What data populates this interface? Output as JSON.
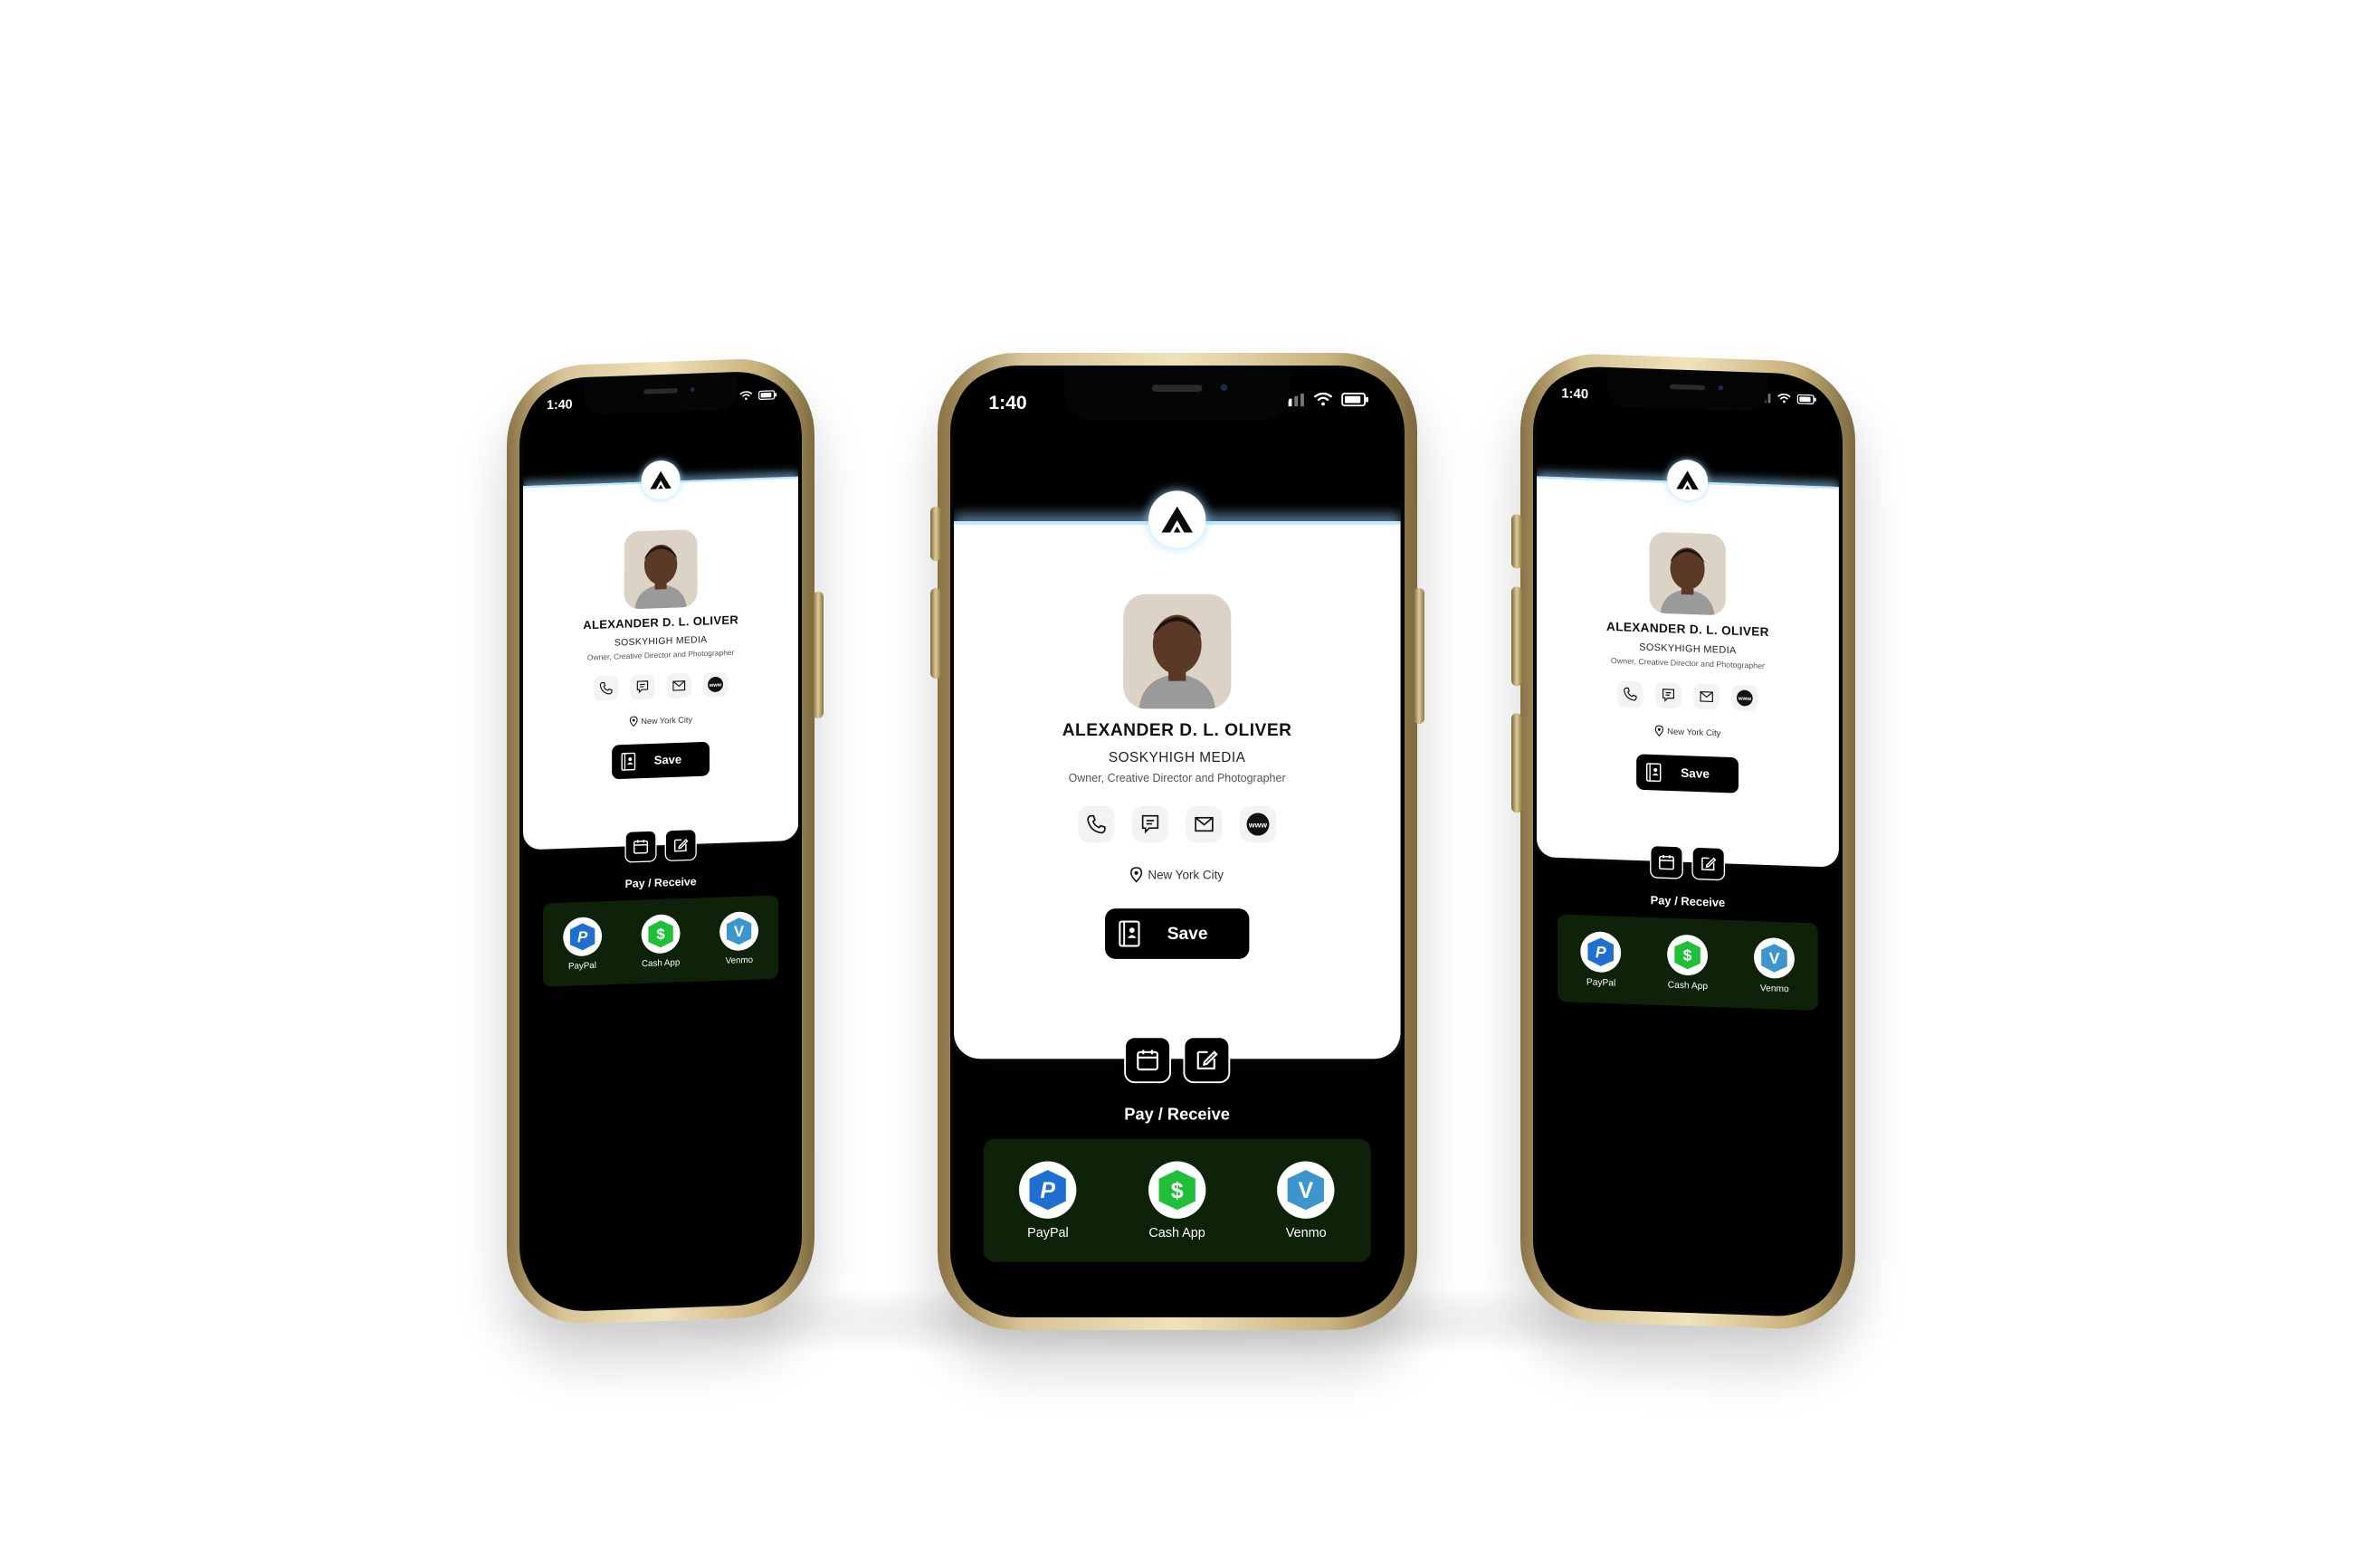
{
  "status": {
    "time": "1:40"
  },
  "logo": {
    "icon": "a-mountain-logo-icon"
  },
  "profile": {
    "name": "ALEXANDER D. L. OLIVER",
    "company": "SOSKYHIGH MEDIA",
    "role": "Owner, Creative Director and Photographer",
    "location": "New York City"
  },
  "contact_actions": [
    {
      "icon": "phone-icon"
    },
    {
      "icon": "message-icon"
    },
    {
      "icon": "email-icon"
    },
    {
      "icon": "website-icon",
      "text": "www"
    }
  ],
  "save_button": {
    "label": "Save",
    "icon": "contact-book-icon"
  },
  "tools": [
    {
      "icon": "calendar-icon"
    },
    {
      "icon": "edit-note-icon"
    }
  ],
  "payments": {
    "title": "Pay / Receive",
    "items": [
      {
        "label": "PayPal",
        "glyph": "P",
        "color": "#1f6fd1"
      },
      {
        "label": "Cash App",
        "glyph": "$",
        "color": "#1fbf3a"
      },
      {
        "label": "Venmo",
        "glyph": "V",
        "color": "#3d95ce"
      }
    ]
  },
  "colors": {
    "frame": "#d8c596",
    "screen": "#000000",
    "card": "#ffffff",
    "pay_panel": "#0d2209",
    "glow": "#bfe6ff"
  }
}
